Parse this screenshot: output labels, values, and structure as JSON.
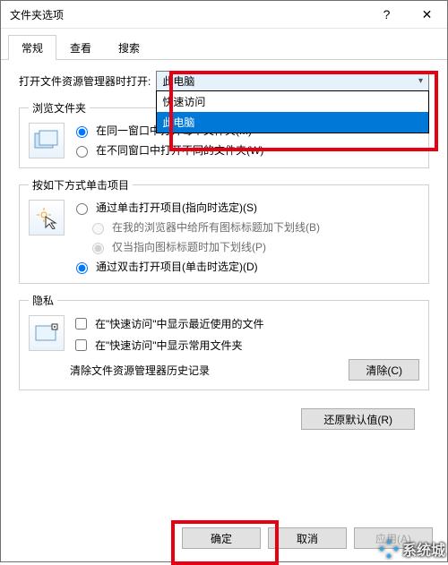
{
  "window": {
    "title": "文件夹选项"
  },
  "titlebar": {
    "help": "?",
    "close": "✕"
  },
  "tabs": {
    "items": [
      "常规",
      "查看",
      "搜索"
    ],
    "active": 0
  },
  "open_with": {
    "label": "打开文件资源管理器时打开:",
    "selected": "此电脑",
    "options": [
      "快速访问",
      "此电脑"
    ],
    "highlight_index": 1
  },
  "browse": {
    "legend": "浏览文件夹",
    "same": "在同一窗口中打开每个文件夹(M)",
    "diff": "在不同窗口中打开不同的文件夹(W)"
  },
  "click": {
    "legend": "按如下方式单击项目",
    "single": "通过单击打开项目(指向时选定)(S)",
    "under_all": "在我的浏览器中给所有图标标题加下划线(B)",
    "under_point": "仅当指向图标标题时加下划线(P)",
    "double": "通过双击打开项目(单击时选定)(D)"
  },
  "privacy": {
    "legend": "隐私",
    "recent": "在\"快速访问\"中显示最近使用的文件",
    "frequent": "在\"快速访问\"中显示常用文件夹",
    "clear_label": "清除文件资源管理器历史记录",
    "clear_btn": "清除(C)"
  },
  "buttons": {
    "restore": "还原默认值(R)",
    "ok": "确定",
    "cancel": "取消",
    "apply": "应用(A)"
  },
  "watermark": {
    "text": "系统城"
  }
}
